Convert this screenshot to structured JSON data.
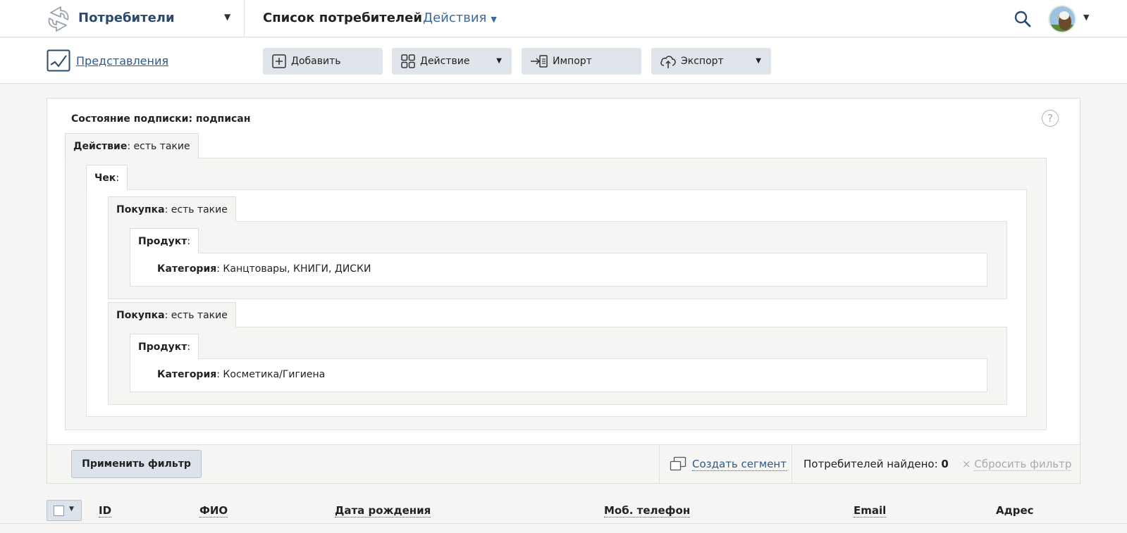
{
  "header": {
    "section_title": "Потребители",
    "page_title": "Список потребителей",
    "actions_menu": "Действия"
  },
  "toolbar": {
    "views_label": "Представления",
    "add_label": "Добавить",
    "action_label": "Действие",
    "import_label": "Импорт",
    "export_label": "Экспорт"
  },
  "filter": {
    "subscription_label": "Состояние подписки: подписан",
    "action_key": "Действие",
    "action_value": ": есть такие",
    "check_key": "Чек",
    "check_value": ":",
    "purchase1_key": "Покупка",
    "purchase1_value": ": есть такие",
    "product1_key": "Продукт",
    "product1_value": ":",
    "category1_key": "Категория",
    "category1_value": ": Канцтовары, КНИГИ, ДИСКИ",
    "purchase2_key": "Покупка",
    "purchase2_value": ": есть такие",
    "product2_key": "Продукт",
    "product2_value": ":",
    "category2_key": "Категория",
    "category2_value": ": Косметика/Гигиена",
    "help_symbol": "?"
  },
  "footer": {
    "apply_label": "Применить фильтр",
    "create_segment_label": "Создать сегмент",
    "found_label": "Потребителей найдено: ",
    "found_count": "0",
    "reset_symbol": "×",
    "reset_label": "Сбросить фильтр"
  },
  "table": {
    "columns": [
      "ID",
      "ФИО",
      "Дата рождения",
      "Моб. телефон",
      "Email",
      "Адрес"
    ]
  },
  "colors": {
    "brand": "#2c4a6e",
    "link": "#2c5a8c",
    "button_bg": "#dfe5ea"
  },
  "icons": {
    "logo": "sync-arrows-icon",
    "search": "search-icon",
    "views": "chart-views-icon",
    "add": "plus-square-icon",
    "action": "grid-icon",
    "import": "import-icon",
    "export": "cloud-upload-icon",
    "create_segment": "copy-segment-icon",
    "help": "help-icon"
  }
}
